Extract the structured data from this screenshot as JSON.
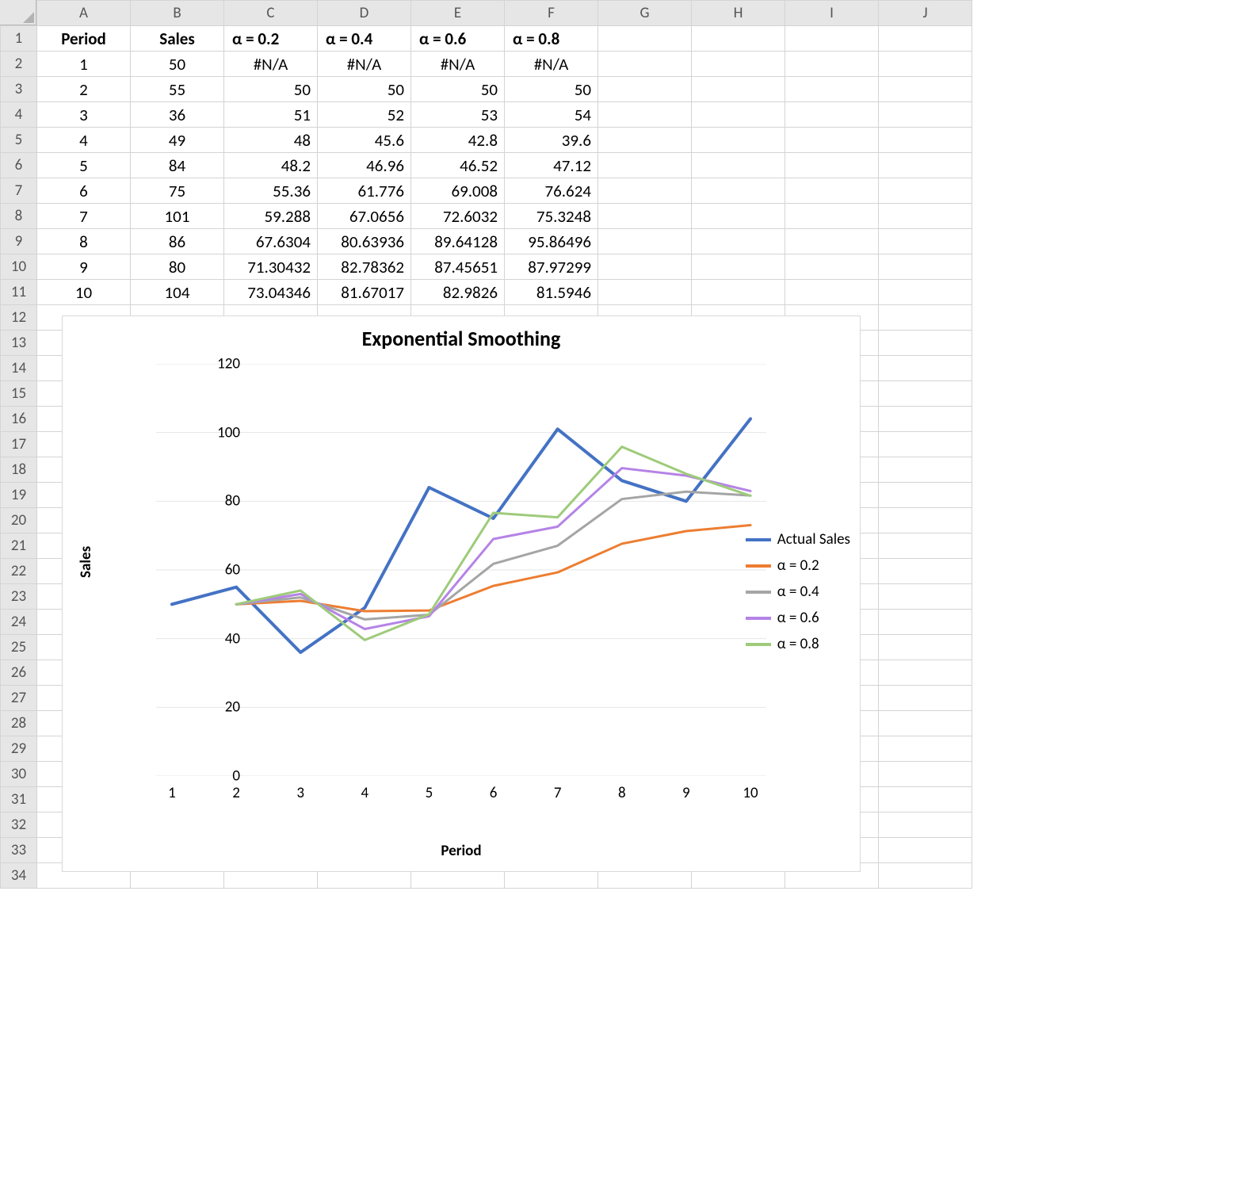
{
  "sheet": {
    "columns": [
      "A",
      "B",
      "C",
      "D",
      "E",
      "F",
      "G",
      "H",
      "I",
      "J"
    ],
    "row_count": 34,
    "headers": [
      "Period",
      "Sales",
      "α = 0.2",
      "α = 0.4",
      "α = 0.6",
      "α = 0.8"
    ],
    "rows": [
      [
        "1",
        "50",
        "#N/A",
        "#N/A",
        "#N/A",
        "#N/A"
      ],
      [
        "2",
        "55",
        "50",
        "50",
        "50",
        "50"
      ],
      [
        "3",
        "36",
        "51",
        "52",
        "53",
        "54"
      ],
      [
        "4",
        "49",
        "48",
        "45.6",
        "42.8",
        "39.6"
      ],
      [
        "5",
        "84",
        "48.2",
        "46.96",
        "46.52",
        "47.12"
      ],
      [
        "6",
        "75",
        "55.36",
        "61.776",
        "69.008",
        "76.624"
      ],
      [
        "7",
        "101",
        "59.288",
        "67.0656",
        "72.6032",
        "75.3248"
      ],
      [
        "8",
        "86",
        "67.6304",
        "80.63936",
        "89.64128",
        "95.86496"
      ],
      [
        "9",
        "80",
        "71.30432",
        "82.78362",
        "87.45651",
        "87.97299"
      ],
      [
        "10",
        "104",
        "73.04346",
        "81.67017",
        "82.9826",
        "81.5946"
      ]
    ],
    "col_align": {
      "A": "c",
      "B": "c",
      "C_row2": "c",
      "D_row2": "c",
      "E_row2": "c",
      "F_row2": "c"
    }
  },
  "chart_data": {
    "type": "line",
    "title": "Exponential Smoothing",
    "xlabel": "Period",
    "ylabel": "Sales",
    "x": [
      1,
      2,
      3,
      4,
      5,
      6,
      7,
      8,
      9,
      10
    ],
    "ylim": [
      0,
      120
    ],
    "yticks": [
      0,
      20,
      40,
      60,
      80,
      100,
      120
    ],
    "series": [
      {
        "name": "Actual Sales",
        "color": "#4472c4",
        "width": 4,
        "values": [
          50,
          55,
          36,
          49,
          84,
          75,
          101,
          86,
          80,
          104
        ]
      },
      {
        "name": "α = 0.2",
        "color": "#ed7d31",
        "width": 3,
        "values": [
          null,
          50,
          51,
          48,
          48.2,
          55.36,
          59.288,
          67.6304,
          71.30432,
          73.04346
        ]
      },
      {
        "name": "α = 0.4",
        "color": "#a5a5a5",
        "width": 3,
        "values": [
          null,
          50,
          52,
          45.6,
          46.96,
          61.776,
          67.0656,
          80.63936,
          82.78362,
          81.67017
        ]
      },
      {
        "name": "α = 0.6",
        "color": "#b583e6",
        "width": 3,
        "values": [
          null,
          50,
          53,
          42.8,
          46.52,
          69.008,
          72.6032,
          89.64128,
          87.45651,
          82.9826
        ]
      },
      {
        "name": "α = 0.8",
        "color": "#9ecb7a",
        "width": 3,
        "values": [
          null,
          50,
          54,
          39.6,
          47.12,
          76.624,
          75.3248,
          95.86496,
          87.97299,
          81.5946
        ]
      }
    ],
    "legend_position": "right"
  }
}
